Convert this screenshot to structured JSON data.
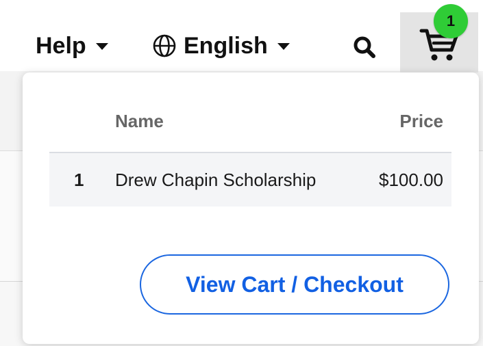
{
  "nav": {
    "help_label": "Help",
    "language_label": "English",
    "cart_count": "1"
  },
  "cart": {
    "columns": {
      "number": "",
      "name": "Name",
      "price": "Price"
    },
    "items": [
      {
        "number": "1",
        "name": "Drew Chapin Scholarship",
        "price": "$100.00"
      }
    ],
    "checkout_label": "View Cart / Checkout"
  },
  "colors": {
    "accent": "#1260e3",
    "badge": "#2fcc36",
    "text": "#111111"
  }
}
